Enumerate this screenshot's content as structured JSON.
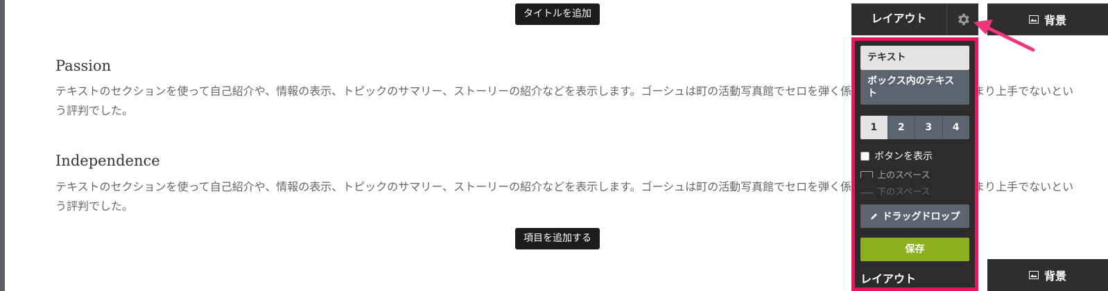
{
  "editor": {
    "add_title_label": "タイトルを追加",
    "add_item_label": "項目を追加する"
  },
  "sections": [
    {
      "title": "Passion",
      "text": "テキストのセクションを使って自己紹介や、情報の表示、トピックのサマリー、ストーリーの紹介などを表示します。ゴーシュは町の活動写真館でセロを弾く係りでした。けれどもあんまり上手でないという評判でした。"
    },
    {
      "title": "Independence",
      "text": "テキストのセクションを使って自己紹介や、情報の表示、トピックのサマリー、ストーリーの紹介などを表示します。ゴーシュは町の活動写真館でセロを弾く係りでした。けれどもあんまり上手でないという評判でした。"
    }
  ],
  "toolbar": {
    "layout_label": "レイアウト",
    "background_label": "背景",
    "gear_icon": "gear-icon",
    "image_icon": "image-icon"
  },
  "panel": {
    "options": [
      "テキスト",
      "ボックス内のテキスト"
    ],
    "columns": [
      "1",
      "2",
      "3",
      "4"
    ],
    "selected_column": "1",
    "show_button_label": "ボタンを表示",
    "top_space_label": "上のスペース",
    "bottom_space_label": "下のスペース",
    "dragdrop_label": "ドラッグドロップ",
    "save_label": "保存",
    "ghost_layout_label": "レイアウト"
  },
  "colors": {
    "highlight_border": "#e8155f",
    "save_green": "#8cb11d",
    "panel_bg": "#2c2c2c"
  }
}
